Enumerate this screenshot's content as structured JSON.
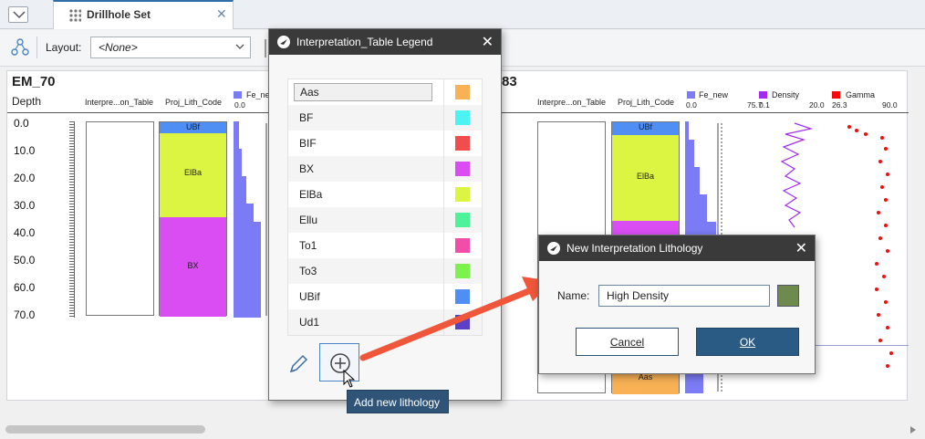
{
  "tab": {
    "title": "Drillhole Set",
    "close": "✕"
  },
  "toolbar": {
    "layout_label": "Layout:",
    "layout_value": "<None>"
  },
  "log_view": {
    "left_hole": {
      "name": "EM_70",
      "depth_header": "Depth",
      "columns": [
        "Interpre...on_Table",
        "Proj_Lith_Code",
        "Fe_new"
      ],
      "fe_scale_min": "0.0",
      "depth_ticks": [
        "0.0",
        "10.0",
        "20.0",
        "30.0",
        "40.0",
        "50.0",
        "60.0",
        "70.0"
      ],
      "lithologies": [
        {
          "code": "UBf",
          "color": "#4f8ef2"
        },
        {
          "code": "ElBa",
          "color": "#dcf543"
        },
        {
          "code": "BX",
          "color": "#d94df2"
        }
      ]
    },
    "right_hole": {
      "name_suffix": "83",
      "columns": [
        "Interpre...on_Table",
        "Proj_Lith_Code",
        "Fe_new",
        "Density",
        "Gamma"
      ],
      "legend_colors": {
        "fe": "#7b7bf5",
        "density": "#a12bf0",
        "gamma": "#f20d0d"
      },
      "fe_scale": [
        "0.0",
        "75.7"
      ],
      "density_scale": [
        "0.1",
        "20.0"
      ],
      "gamma_scale": [
        "26.3",
        "90.0"
      ],
      "lithologies": [
        {
          "code": "UBf",
          "color": "#4f8ef2"
        },
        {
          "code": "ElBa",
          "color": "#dcf543"
        },
        {
          "code": "Aas",
          "color": "#f8b155"
        }
      ]
    }
  },
  "legend_dialog": {
    "title": "Interpretation_Table Legend",
    "close": "✕",
    "items": [
      {
        "name": "Aas",
        "color": "#f8b155"
      },
      {
        "name": "BF",
        "color": "#4df2f2"
      },
      {
        "name": "BIF",
        "color": "#f24d4d"
      },
      {
        "name": "BX",
        "color": "#d94df2"
      },
      {
        "name": "ElBa",
        "color": "#dcf543"
      },
      {
        "name": "Ellu",
        "color": "#4df29a"
      },
      {
        "name": "To1",
        "color": "#f24da8"
      },
      {
        "name": "To3",
        "color": "#7df24d"
      },
      {
        "name": "UBif",
        "color": "#4f8ef2"
      },
      {
        "name": "Ud1",
        "color": "#5a40c8"
      }
    ],
    "tooltip": "Add new lithology"
  },
  "new_dialog": {
    "title": "New Interpretation Lithology",
    "close": "✕",
    "name_label": "Name:",
    "name_value": "High Density",
    "color": "#6f8a4e",
    "cancel_label": "Cancel",
    "ok_label": "OK"
  },
  "colors": {
    "arrow": "#f0573a",
    "accent": "#2a5b85"
  }
}
